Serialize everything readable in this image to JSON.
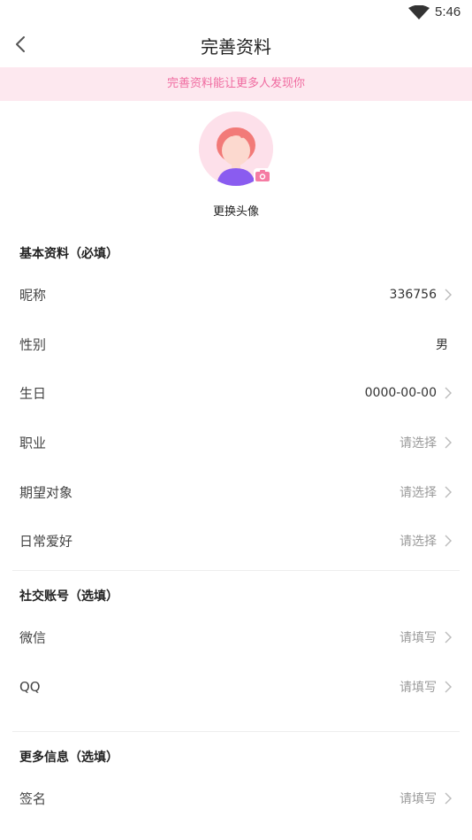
{
  "status_bar": {
    "time": "5:46",
    "wifi_icon": "wifi-icon"
  },
  "nav": {
    "title": "完善资料",
    "back_icon": "chevron-left-icon"
  },
  "banner": {
    "text": "完善资料能让更多人发现你"
  },
  "avatar": {
    "label": "更换头像",
    "badge_icon": "camera-icon"
  },
  "sections": {
    "basic": {
      "title": "基本资料（必填）",
      "rows": [
        {
          "label": "昵称",
          "value": "336756"
        },
        {
          "label": "性别",
          "value": "男"
        },
        {
          "label": "生日",
          "value": "0000-00-00"
        },
        {
          "label": "职业",
          "value": "请选择"
        },
        {
          "label": "期望对象",
          "value": "请选择"
        },
        {
          "label": "日常爱好",
          "value": "请选择"
        }
      ]
    },
    "social": {
      "title": "社交账号（选填）",
      "rows": [
        {
          "label": "微信",
          "value": "请填写"
        },
        {
          "label": "QQ",
          "value": "请填写"
        }
      ]
    },
    "more": {
      "title": "更多信息（选填）",
      "rows": [
        {
          "label": "签名",
          "value": "请填写"
        }
      ]
    }
  },
  "colors": {
    "accent": "#f06ba0",
    "banner_bg": "#fde8ef",
    "placeholder": "#9a9a9a"
  }
}
